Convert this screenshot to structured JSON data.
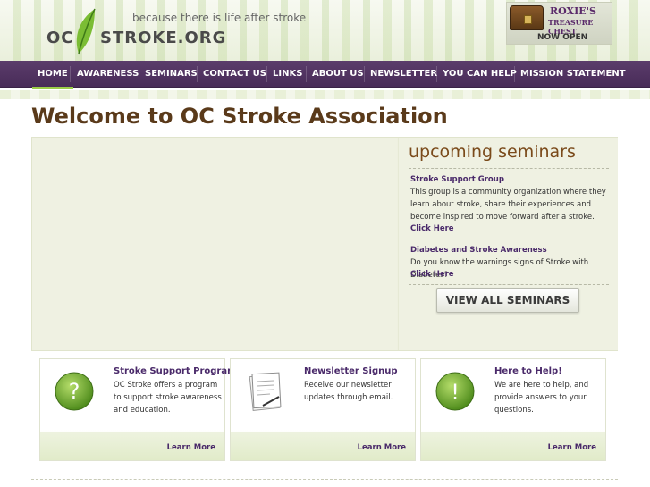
{
  "header": {
    "logo_left": "OC",
    "logo_right": "STROKE.ORG",
    "tagline": "because there is life after stroke",
    "promo": {
      "title": "ROXIE'S",
      "subtitle": "TREASURE CHEST",
      "status": "NOW OPEN"
    }
  },
  "nav": {
    "items": [
      {
        "label": "HOME"
      },
      {
        "label": "AWARENESS"
      },
      {
        "label": "SEMINARS"
      },
      {
        "label": "CONTACT US"
      },
      {
        "label": "LINKS"
      },
      {
        "label": "ABOUT US"
      },
      {
        "label": "NEWSLETTER"
      },
      {
        "label": "YOU CAN HELP"
      },
      {
        "label": "MISSION STATEMENT"
      }
    ]
  },
  "main": {
    "title": "Welcome to OC Stroke Association"
  },
  "seminars": {
    "heading": "upcoming seminars",
    "items": [
      {
        "title": "Stroke Support Group",
        "description": "This group is a community organization where they learn about stroke, share their experiences and become inspired to move forward after a stroke.",
        "link": "Click Here"
      },
      {
        "title": "Diabetes and Stroke Awareness",
        "description": "Do you know the warnings signs of Stroke with Diabetes?",
        "link": "Click Here"
      }
    ],
    "view_all": "VIEW ALL SEMINARS"
  },
  "cards": [
    {
      "title": "Stroke Support Program",
      "text": "OC Stroke offers a program to support stroke awareness and education.",
      "link": "Learn More",
      "icon": "question-icon"
    },
    {
      "title": "Newsletter Signup",
      "text": "Receive our newsletter updates through email.",
      "link": "Learn More",
      "icon": "newsletter-icon"
    },
    {
      "title": "Here to Help!",
      "text": "We are here to help, and provide answers to your questions.",
      "link": "Learn More",
      "icon": "exclamation-icon"
    }
  ],
  "colors": {
    "nav_bg": "#4f3160",
    "accent_green": "#9ccd4a",
    "link_purple": "#4a2a6a",
    "title_brown": "#5a3a1a"
  }
}
